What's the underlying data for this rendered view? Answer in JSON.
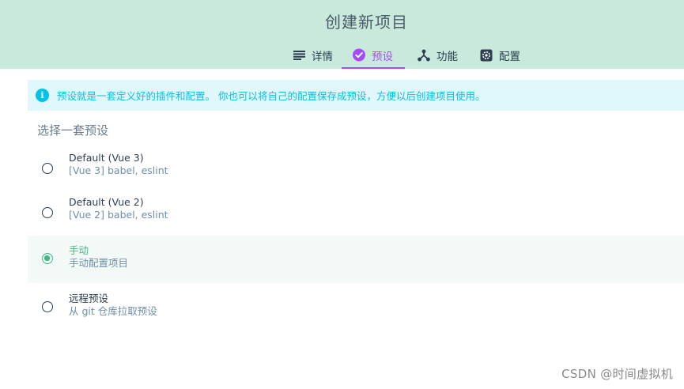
{
  "header": {
    "title": "创建新项目"
  },
  "tabs": [
    {
      "label": "详情",
      "icon": "list-icon",
      "active": false
    },
    {
      "label": "预设",
      "icon": "check-circle-icon",
      "active": true
    },
    {
      "label": "功能",
      "icon": "branch-icon",
      "active": false
    },
    {
      "label": "配置",
      "icon": "gear-icon",
      "active": false
    }
  ],
  "info": {
    "text": "预设就是一套定义好的插件和配置。 你也可以将自己的配置保存成预设，方便以后创建项目使用。"
  },
  "section": {
    "title": "选择一套预设"
  },
  "presets": [
    {
      "name": "Default (Vue 3)",
      "desc": "[Vue 3] babel, eslint",
      "selected": false
    },
    {
      "name": "Default (Vue 2)",
      "desc": "[Vue 2] babel, eslint",
      "selected": false
    },
    {
      "name": "手动",
      "desc": "手动配置项目",
      "selected": true
    },
    {
      "name": "远程预设",
      "desc": "从 git 仓库拉取预设",
      "selected": false
    }
  ],
  "watermark": "CSDN @时间虚拟机",
  "colors": {
    "header_bg": "#c8e9dc",
    "accent_purple": "#a44cf7",
    "accent_green": "#42b883",
    "info": "#03c2e6"
  }
}
